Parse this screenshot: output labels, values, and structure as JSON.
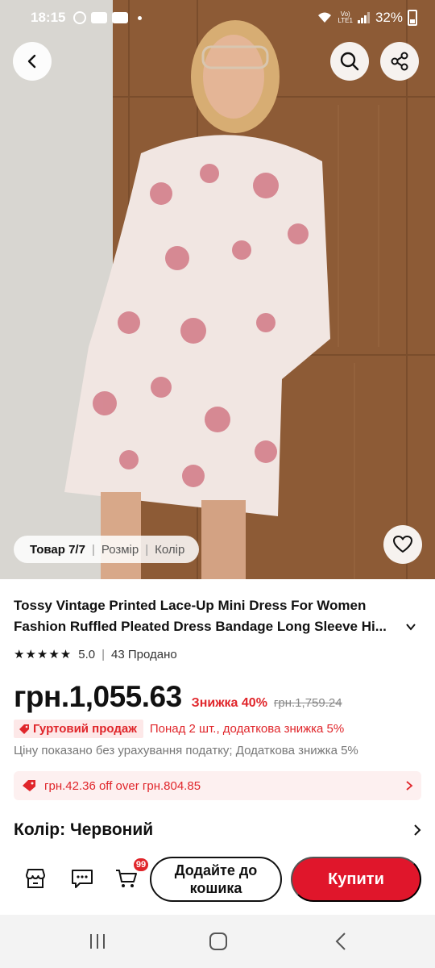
{
  "status_bar": {
    "time": "18:15",
    "lte": "Vo)\nLTE1",
    "battery": "32%"
  },
  "gallery": {
    "current_label": "Товар 7/7",
    "size_label": "Розмір",
    "color_label": "Колір"
  },
  "product": {
    "title_line1": "Tossy Vintage Printed Lace-Up Mini Dress For Women",
    "title_line2": "Fashion Ruffled Pleated Dress Bandage Long Sleeve Hi...",
    "rating": "5.0",
    "sold": "43 Продано",
    "price": "грн.1,055.63",
    "discount": "Знижка 40%",
    "old_price": "грн.1,759.24",
    "wholesale_badge": "Гуртовий продаж",
    "wholesale_text": "Понад 2 шт., додаткова знижка 5%",
    "tax_note": "Ціну показано без урахування податку; Додаткова знижка 5%",
    "coupon_text": "грн.42.36 off over грн.804.85",
    "color_row": "Колір: Червоний"
  },
  "actions": {
    "cart_count": "99",
    "add_to_cart_line1": "Додайте до",
    "add_to_cart_line2": "кошика",
    "buy_label": "Купити"
  },
  "colors": {
    "accent": "#e0162b",
    "discount": "#e0262b"
  }
}
